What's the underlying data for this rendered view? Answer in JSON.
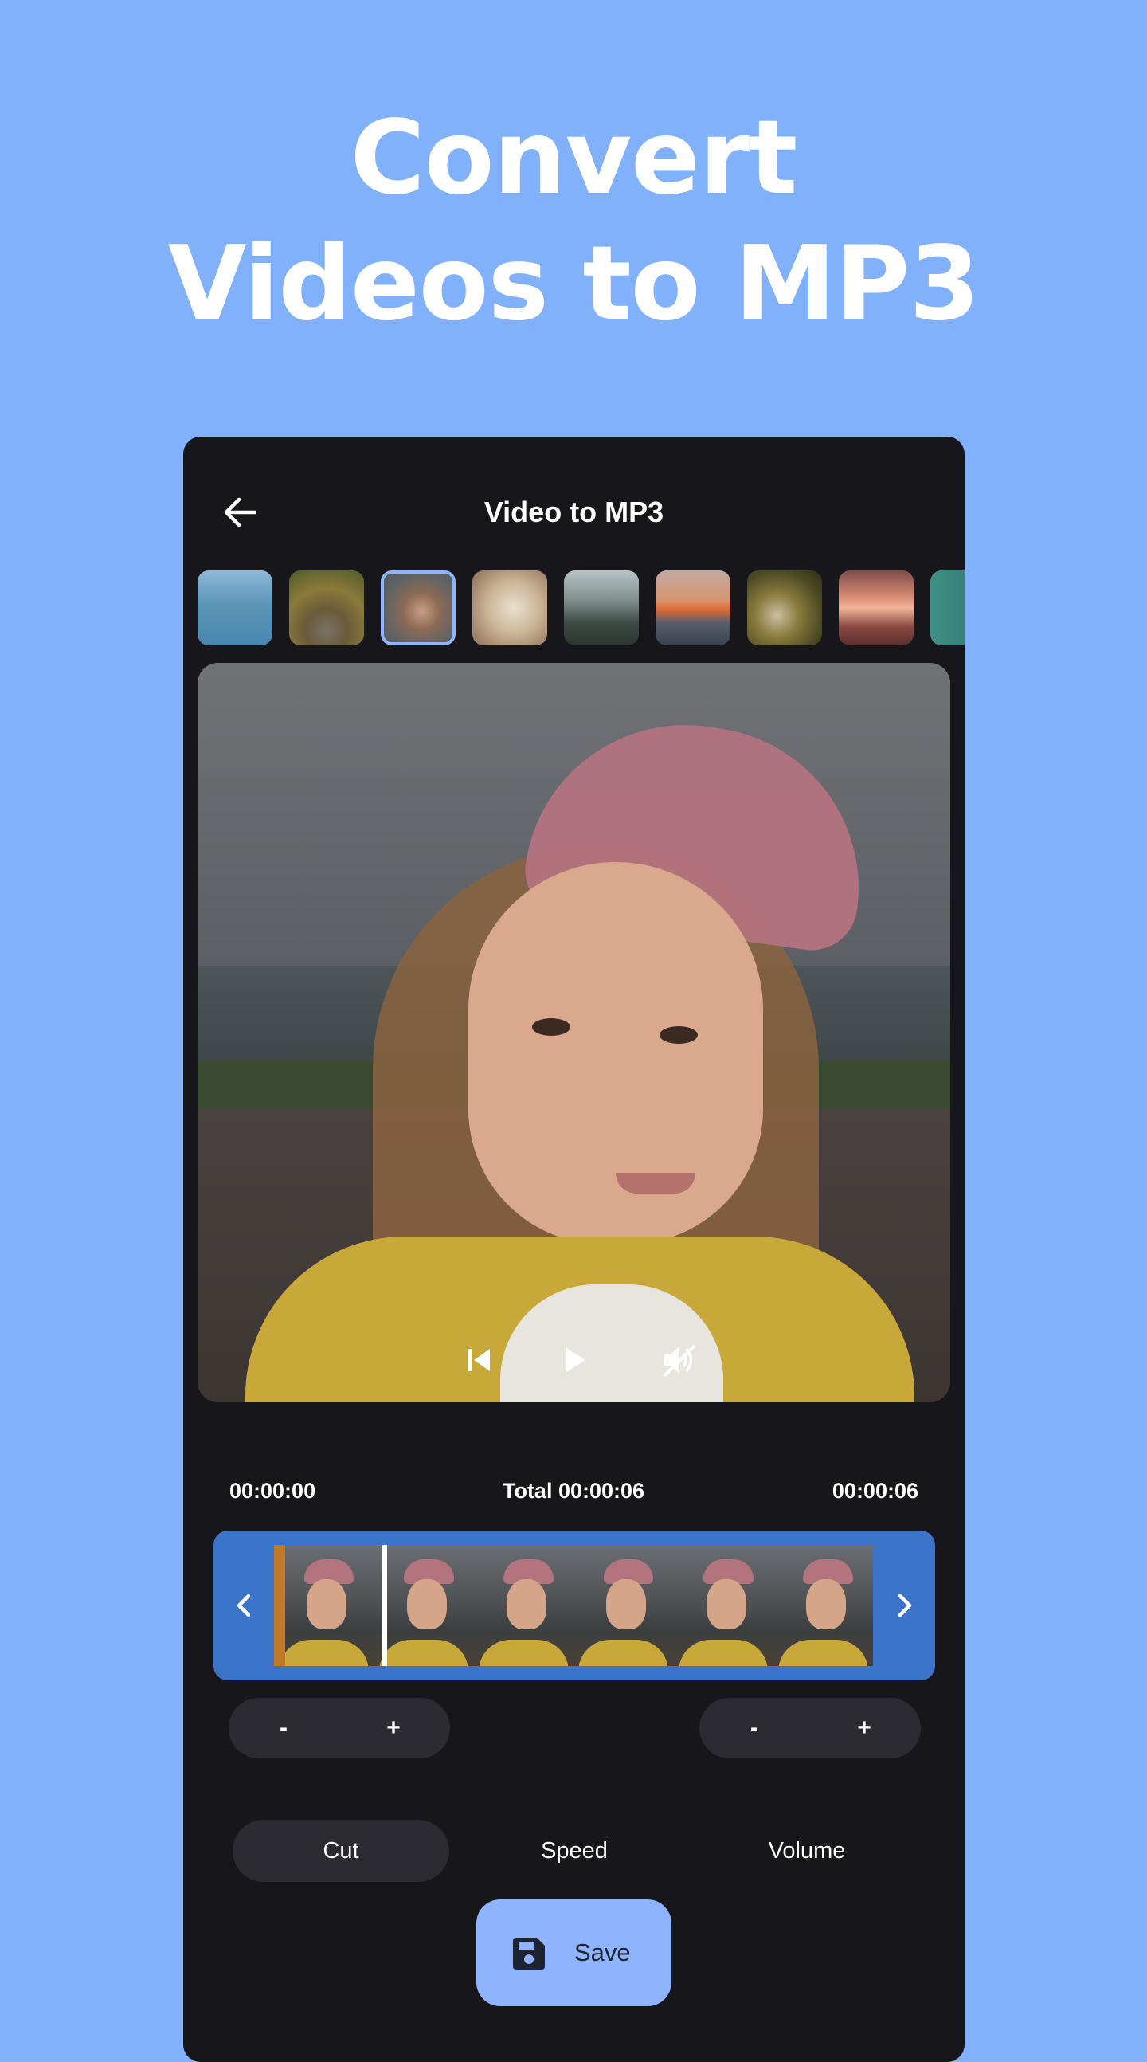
{
  "headline": {
    "line1": "Convert",
    "line2": "Videos to MP3"
  },
  "app": {
    "title": "Video to MP3",
    "back_icon": "arrow-left-icon"
  },
  "thumbnails": [
    {
      "name": "sea",
      "selected": false
    },
    {
      "name": "forest-road",
      "selected": false
    },
    {
      "name": "woman-portrait",
      "selected": true
    },
    {
      "name": "fluffy-dog",
      "selected": false
    },
    {
      "name": "lake-dock",
      "selected": false
    },
    {
      "name": "sunset-boat",
      "selected": false
    },
    {
      "name": "forest-stream",
      "selected": false
    },
    {
      "name": "pink-sunset",
      "selected": false
    },
    {
      "name": "teal-partial",
      "selected": false
    }
  ],
  "player": {
    "controls": [
      "skip-previous-icon",
      "play-icon",
      "volume-off-icon"
    ]
  },
  "timeline": {
    "start": "00:00:00",
    "total": "Total 00:00:06",
    "end": "00:00:06",
    "playhead_fraction": 0.18
  },
  "steppers": {
    "left": {
      "minus": "-",
      "plus": "+"
    },
    "right": {
      "minus": "-",
      "plus": "+"
    }
  },
  "tabs": [
    {
      "label": "Cut",
      "active": true
    },
    {
      "label": "Speed",
      "active": false
    },
    {
      "label": "Volume",
      "active": false
    }
  ],
  "save": {
    "label": "Save",
    "icon": "floppy-disk-icon"
  },
  "colors": {
    "background": "#82b1fc",
    "panel": "#17161b",
    "accent": "#8fb4ff",
    "trimmer": "#3b73c9"
  }
}
